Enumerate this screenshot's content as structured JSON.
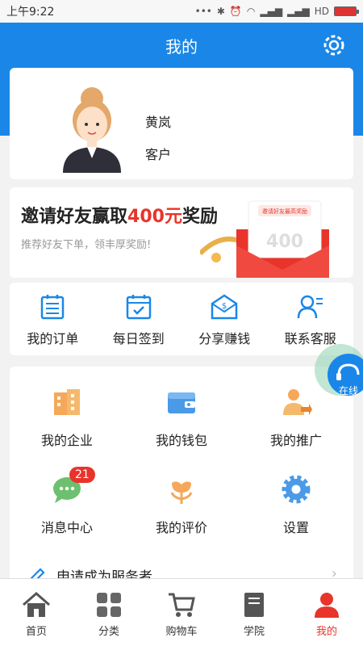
{
  "statusbar": {
    "time": "上午9:22",
    "network": "HD"
  },
  "header": {
    "title": "我的"
  },
  "profile": {
    "name": "黄岚",
    "role": "客户"
  },
  "banner": {
    "title_prefix": "邀请好友赢取",
    "title_highlight": "400元",
    "title_suffix": "奖励",
    "subtitle": "推荐好友下单，领丰厚奖励!",
    "envelope_label": "邀请好友最高奖励",
    "envelope_amount": "400"
  },
  "quick": [
    {
      "label": "我的订单",
      "icon": "order-icon"
    },
    {
      "label": "每日签到",
      "icon": "calendar-check-icon"
    },
    {
      "label": "分享赚钱",
      "icon": "share-money-icon"
    },
    {
      "label": "联系客服",
      "icon": "customer-service-icon"
    }
  ],
  "grid": [
    {
      "label": "我的企业",
      "icon": "building-icon"
    },
    {
      "label": "我的钱包",
      "icon": "wallet-icon"
    },
    {
      "label": "我的推广",
      "icon": "promotion-icon"
    },
    {
      "label": "消息中心",
      "icon": "message-icon",
      "badge": "21"
    },
    {
      "label": "我的评价",
      "icon": "flower-icon"
    },
    {
      "label": "设置",
      "icon": "settings-icon"
    }
  ],
  "apply": {
    "label": "申请成为服务者"
  },
  "float_widget": {
    "label": "在线"
  },
  "tabs": [
    {
      "label": "首页",
      "icon": "home-icon"
    },
    {
      "label": "分类",
      "icon": "category-icon"
    },
    {
      "label": "购物车",
      "icon": "cart-icon"
    },
    {
      "label": "学院",
      "icon": "book-icon"
    },
    {
      "label": "我的",
      "icon": "user-icon",
      "active": true
    }
  ],
  "colors": {
    "primary": "#1a87e8",
    "accent": "#e8342b"
  }
}
